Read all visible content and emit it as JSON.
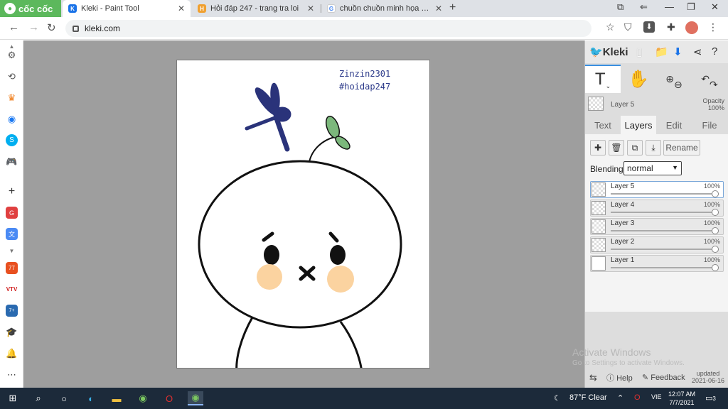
{
  "browser": {
    "brand": "cốc cốc",
    "tabs": [
      {
        "title": "Kleki - Paint Tool",
        "active": true,
        "favicon_color": "#1a73e8"
      },
      {
        "title": "Hỏi đáp 247 - trang tra loi",
        "active": false,
        "favicon_color": "#f0a030"
      },
      {
        "title": "chuồn chuồn minh họa - Goo",
        "active": false,
        "favicon_color": "#4285f4"
      }
    ],
    "url": "kleki.com"
  },
  "canvas": {
    "signature_line1": "Zinzin2301",
    "signature_line2": "#hoidap247"
  },
  "kleki": {
    "logo": "Kleki",
    "tools": [
      "T",
      "✋"
    ],
    "current_layer": "Layer 5",
    "opacity_label": "Opacity",
    "opacity_value": "100%",
    "panel_tabs": [
      "Text",
      "Layers",
      "Edit",
      "File"
    ],
    "active_tab": "Layers",
    "rename_label": "Rename",
    "blending_label": "Blending",
    "blending_value": "normal",
    "layers": [
      {
        "name": "Layer 5",
        "opacity": "100%",
        "selected": true
      },
      {
        "name": "Layer 4",
        "opacity": "100%",
        "selected": false
      },
      {
        "name": "Layer 3",
        "opacity": "100%",
        "selected": false
      },
      {
        "name": "Layer 2",
        "opacity": "100%",
        "selected": false
      },
      {
        "name": "Layer 1",
        "opacity": "100%",
        "selected": false
      }
    ],
    "help_label": "Help",
    "feedback_label": "Feedback",
    "updated_label": "updated",
    "updated_date": "2021-06-16"
  },
  "watermark": {
    "title": "Activate Windows",
    "subtitle": "Go to Settings to activate Windows."
  },
  "taskbar": {
    "weather": "87°F  Clear",
    "language": "VIE",
    "time": "12:07 AM",
    "date": "7/7/2021",
    "notifications": "3"
  }
}
